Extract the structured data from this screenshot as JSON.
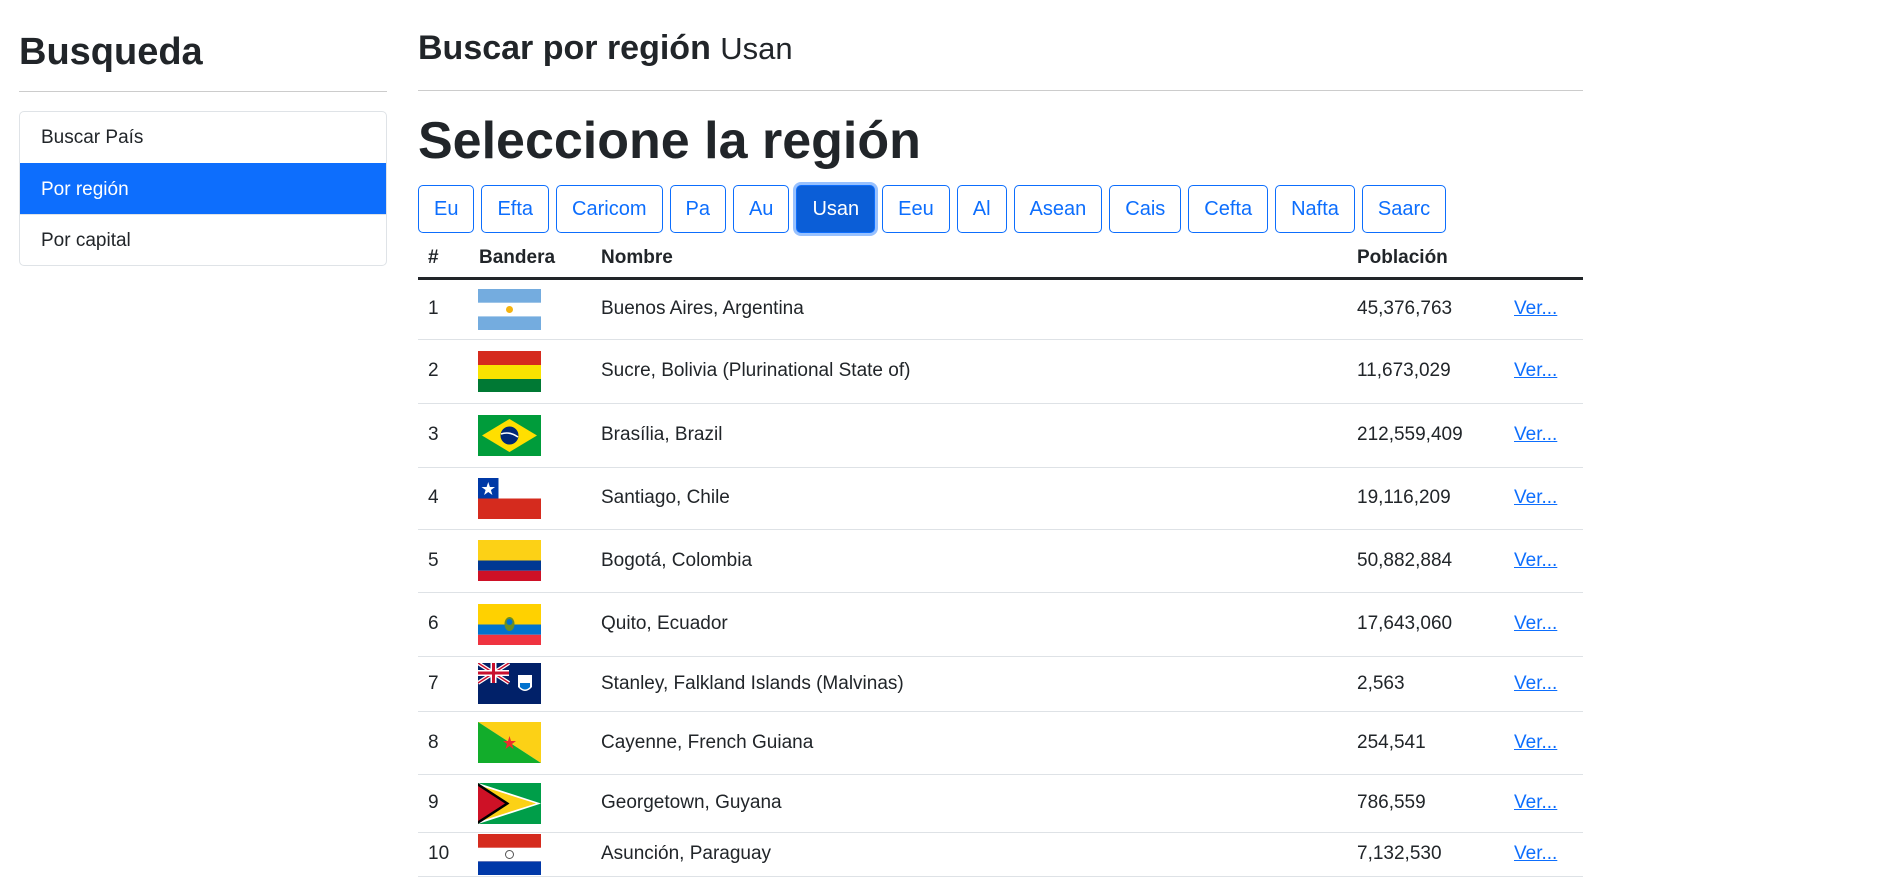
{
  "sidebar": {
    "title": "Busqueda",
    "items": [
      {
        "label": "Buscar País",
        "active": false
      },
      {
        "label": "Por región",
        "active": true
      },
      {
        "label": "Por capital",
        "active": false
      }
    ]
  },
  "main": {
    "heading": "Buscar por región",
    "heading_region": "Usan",
    "subheading": "Seleccione la región",
    "regions": [
      "Eu",
      "Efta",
      "Caricom",
      "Pa",
      "Au",
      "Usan",
      "Eeu",
      "Al",
      "Asean",
      "Cais",
      "Cefta",
      "Nafta",
      "Saarc"
    ],
    "active_region": "Usan",
    "table": {
      "headers": [
        "#",
        "Bandera",
        "Nombre",
        "Población",
        ""
      ],
      "rows": [
        {
          "n": "1",
          "flag": "argentina-flag",
          "name": "Buenos Aires, Argentina",
          "population": "45,376,763",
          "link": "Ver..."
        },
        {
          "n": "2",
          "flag": "bolivia-flag",
          "name": "Sucre, Bolivia (Plurinational State of)",
          "population": "11,673,029",
          "link": "Ver..."
        },
        {
          "n": "3",
          "flag": "brazil-flag",
          "name": "Brasília, Brazil",
          "population": "212,559,409",
          "link": "Ver..."
        },
        {
          "n": "4",
          "flag": "chile-flag",
          "name": "Santiago, Chile",
          "population": "19,116,209",
          "link": "Ver..."
        },
        {
          "n": "5",
          "flag": "colombia-flag",
          "name": "Bogotá, Colombia",
          "population": "50,882,884",
          "link": "Ver..."
        },
        {
          "n": "6",
          "flag": "ecuador-flag",
          "name": "Quito, Ecuador",
          "population": "17,643,060",
          "link": "Ver..."
        },
        {
          "n": "7",
          "flag": "falkland-flag",
          "name": "Stanley, Falkland Islands (Malvinas)",
          "population": "2,563",
          "link": "Ver..."
        },
        {
          "n": "8",
          "flag": "french-guiana-flag",
          "name": "Cayenne, French Guiana",
          "population": "254,541",
          "link": "Ver..."
        },
        {
          "n": "9",
          "flag": "guyana-flag",
          "name": "Georgetown, Guyana",
          "population": "786,559",
          "link": "Ver..."
        },
        {
          "n": "10",
          "flag": "paraguay-flag",
          "name": "Asunción, Paraguay",
          "population": "7,132,530",
          "link": "Ver..."
        }
      ]
    }
  },
  "colors": {
    "primary": "#0d6efd",
    "text": "#212529"
  }
}
